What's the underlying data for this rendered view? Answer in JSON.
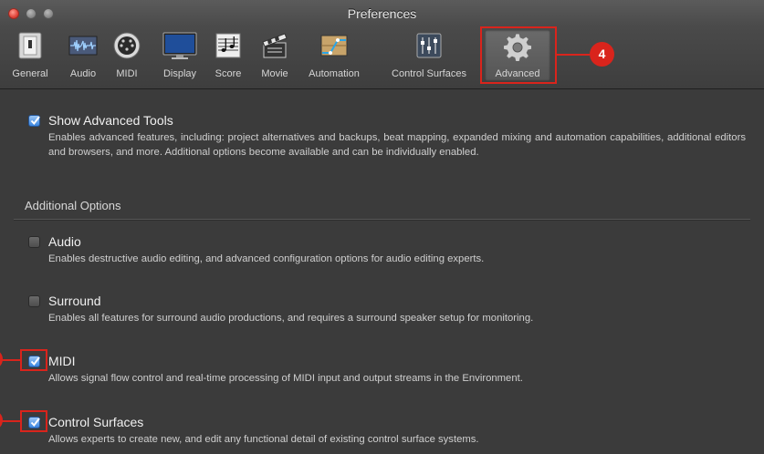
{
  "window": {
    "title": "Preferences"
  },
  "toolbar": {
    "items": [
      {
        "label": "General",
        "icon": "general-switch-icon"
      },
      {
        "label": "Audio",
        "icon": "audio-waveform-icon"
      },
      {
        "label": "MIDI",
        "icon": "midi-connector-icon"
      },
      {
        "label": "Display",
        "icon": "display-monitor-icon"
      },
      {
        "label": "Score",
        "icon": "score-notation-icon"
      },
      {
        "label": "Movie",
        "icon": "movie-clapper-icon"
      },
      {
        "label": "Automation",
        "icon": "automation-curve-icon"
      },
      {
        "label": "Control Surfaces",
        "icon": "control-surfaces-faders-icon"
      },
      {
        "label": "Advanced",
        "icon": "advanced-gear-icon",
        "selected": true
      }
    ]
  },
  "annotations": {
    "badge": "4",
    "color": "#d9241c"
  },
  "options": {
    "show_advanced": {
      "title": "Show Advanced Tools",
      "checked": true,
      "description": "Enables advanced features, including: project alternatives and backups, beat mapping, expanded mixing and automation capabilities, additional editors and browsers, and more. Additional options become available and can be individually enabled."
    },
    "section_label": "Additional Options",
    "audio": {
      "title": "Audio",
      "checked": false,
      "description": "Enables destructive audio editing, and advanced configuration options for audio editing experts."
    },
    "surround": {
      "title": "Surround",
      "checked": false,
      "description": "Enables all features for surround audio productions, and requires a surround speaker setup for monitoring."
    },
    "midi": {
      "title": "MIDI",
      "checked": true,
      "description": "Allows signal flow control and real-time processing of MIDI input and output streams in the Environment."
    },
    "control_surfaces": {
      "title": "Control Surfaces",
      "checked": true,
      "description": "Allows experts to create new, and edit any functional detail of existing control surface systems."
    }
  },
  "colors": {
    "background": "#3b3b3b",
    "checkbox_checked": "#3b86e0",
    "annotation": "#d9241c"
  }
}
